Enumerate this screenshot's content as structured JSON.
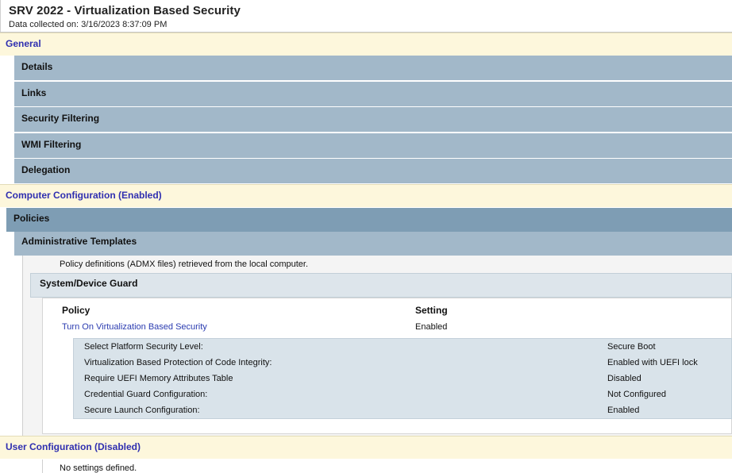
{
  "header": {
    "title": "SRV 2022 - Virtualization Based Security",
    "subtitle": "Data collected on: 3/16/2023 8:37:09 PM"
  },
  "general": {
    "label": "General",
    "items": [
      "Details",
      "Links",
      "Security Filtering",
      "WMI Filtering",
      "Delegation"
    ]
  },
  "computer": {
    "label": "Computer Configuration (Enabled)",
    "policies_label": "Policies",
    "admin_templates_label": "Administrative Templates",
    "admx_note": "Policy definitions (ADMX files) retrieved from the local computer.",
    "device_guard_label": "System/Device Guard",
    "table_headers": {
      "policy": "Policy",
      "setting": "Setting"
    },
    "policy": {
      "name": "Turn On Virtualization Based Security",
      "setting": "Enabled"
    },
    "options": [
      {
        "label": "Select Platform Security Level:",
        "value": "Secure Boot"
      },
      {
        "label": "Virtualization Based Protection of Code Integrity:",
        "value": "Enabled with UEFI lock"
      },
      {
        "label": "Require UEFI Memory Attributes Table",
        "value": "Disabled"
      },
      {
        "label": "Credential Guard Configuration:",
        "value": "Not Configured"
      },
      {
        "label": "Secure Launch Configuration:",
        "value": "Enabled"
      }
    ]
  },
  "user": {
    "label": "User Configuration (Disabled)",
    "note": "No settings defined."
  }
}
